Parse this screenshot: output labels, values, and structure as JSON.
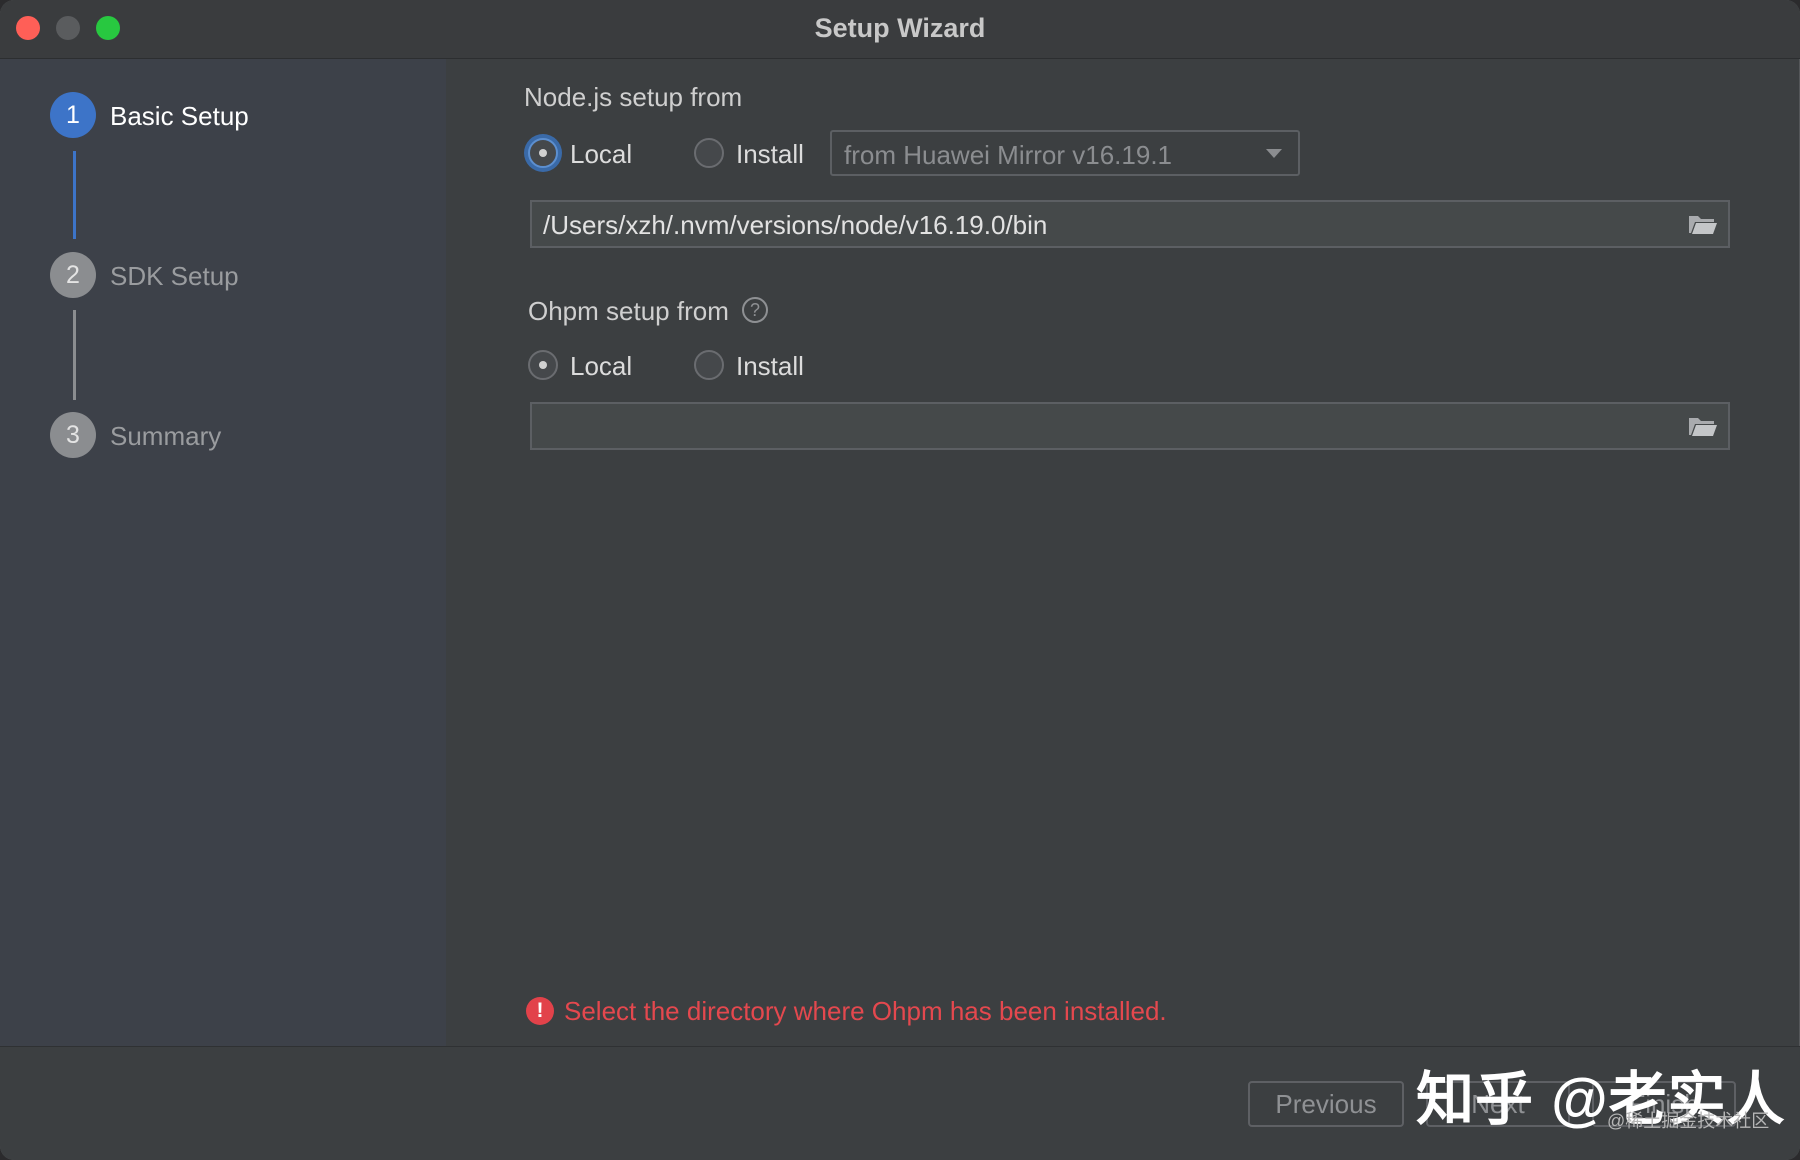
{
  "window": {
    "title": "Setup Wizard"
  },
  "steps": [
    {
      "number": "1",
      "label": "Basic Setup",
      "state": "active"
    },
    {
      "number": "2",
      "label": "SDK Setup",
      "state": "inactive"
    },
    {
      "number": "3",
      "label": "Summary",
      "state": "inactive"
    }
  ],
  "node": {
    "section_title": "Node.js setup from",
    "option_local": "Local",
    "option_install": "Install",
    "selected": "Local",
    "mirror_select": "from Huawei Mirror v16.19.1",
    "path_value": "/Users/xzh/.nvm/versions/node/v16.19.0/bin"
  },
  "ohpm": {
    "section_title": "Ohpm setup from",
    "help_glyph": "?",
    "option_local": "Local",
    "option_install": "Install",
    "selected": "Local",
    "path_value": ""
  },
  "error": {
    "icon_glyph": "!",
    "message": "Select the directory where Ohpm has been installed."
  },
  "footer": {
    "previous_label": "Previous",
    "next_label": "Next",
    "finish_label": "Finish"
  },
  "watermark": {
    "main": "知乎 @老实人",
    "sub": "@稀土掘金技术社区"
  },
  "colors": {
    "accent": "#3d74c8",
    "error": "#e4484e",
    "sidebar_bg": "#3d4149",
    "content_bg": "#3c3f41"
  }
}
